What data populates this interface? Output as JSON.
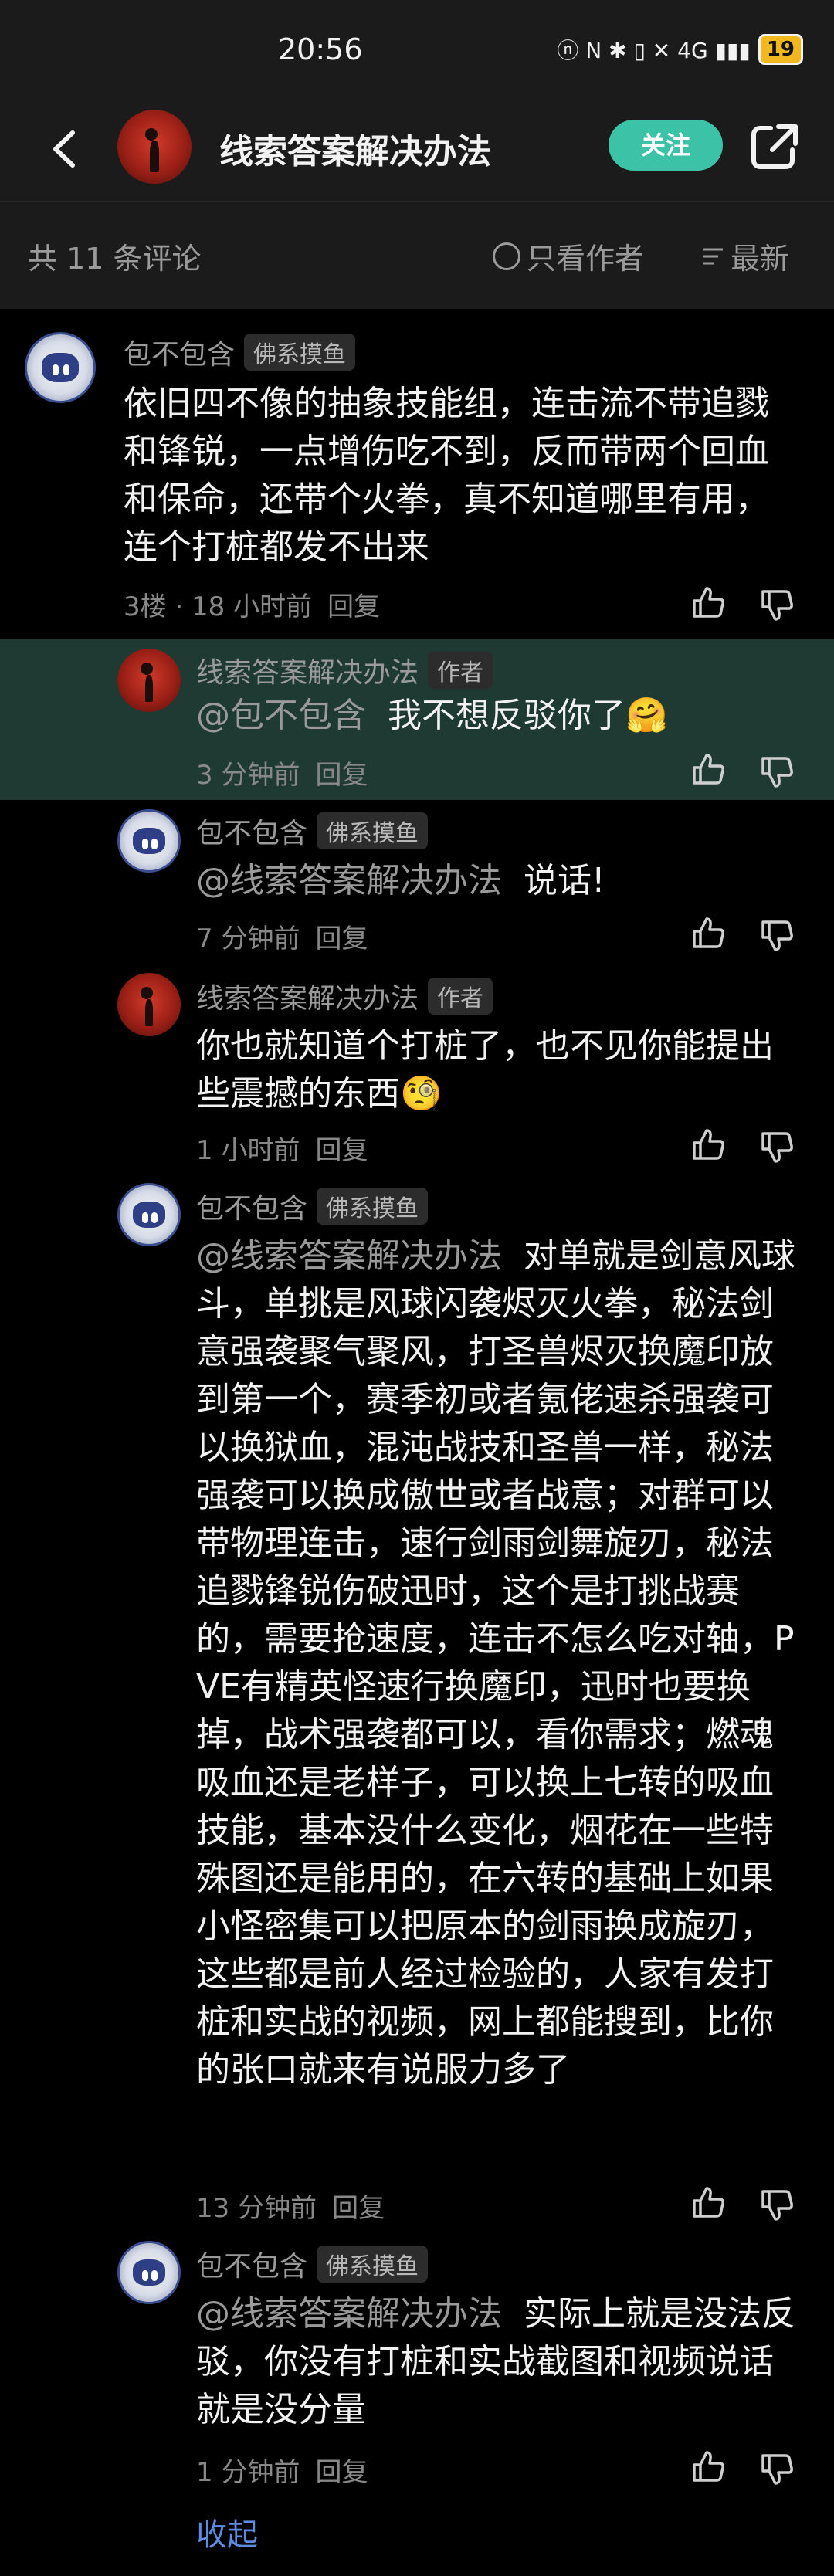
{
  "status_bar": {
    "time": "20:56",
    "icons": "ⓝ N ✱ ▯ ✕ 4G ▮▮▮",
    "battery": "19"
  },
  "header": {
    "title": "线索答案解决办法",
    "follow_label": "关注"
  },
  "filter": {
    "count": "共 11 条评论",
    "author_only": "只看作者",
    "sort": "最新"
  },
  "comments": [
    {
      "user": "包不包含",
      "tag": "佛系摸鱼",
      "text": "依旧四不像的抽象技能组，连击流不带追戮和锋锐，一点增伤吃不到，反而带两个回血和保命，还带个火拳，真不知道哪里有用，连个打桩都发不出来",
      "floor": "3楼 · 18 小时前",
      "reply_label": "回复"
    },
    {
      "user": "线索答案解决办法",
      "tag": "作者",
      "mention": "@包不包含",
      "text": "我不想反驳你了🤗",
      "time": "3 分钟前",
      "reply_label": "回复"
    },
    {
      "user": "包不包含",
      "tag": "佛系摸鱼",
      "mention": "@线索答案解决办法",
      "text": "说话!",
      "time": "7 分钟前",
      "reply_label": "回复"
    },
    {
      "user": "线索答案解决办法",
      "tag": "作者",
      "text": "你也就知道个打桩了，也不见你能提出些震撼的东西🧐",
      "time": "1 小时前",
      "reply_label": "回复"
    },
    {
      "user": "包不包含",
      "tag": "佛系摸鱼",
      "mention": "@线索答案解决办法",
      "text": "对单就是剑意风球斗，单挑是风球闪袭烬灭火拳，秘法剑意强袭聚气聚风，打圣兽烬灭换魔印放到第一个，赛季初或者氪佬速杀强袭可以换狱血，混沌战技和圣兽一样，秘法强袭可以换成傲世或者战意；对群可以带物理连击，速行剑雨剑舞旋刃，秘法追戮锋锐伤破迅时，这个是打挑战赛的，需要抢速度，连击不怎么吃对轴，PVE有精英怪速行换魔印，迅时也要换掉，战术强袭都可以，看你需求；燃魂吸血还是老样子，可以换上七转的吸血技能，基本没什么变化，烟花在一些特殊图还是能用的，在六转的基础上如果小怪密集可以把原本的剑雨换成旋刃，这些都是前人经过检验的，人家有发打桩和实战的视频，网上都能搜到，比你的张口就来有说服力多了",
      "time": "13 分钟前",
      "reply_label": "回复"
    },
    {
      "user": "包不包含",
      "tag": "佛系摸鱼",
      "mention": "@线索答案解决办法",
      "text": "实际上就是没法反驳，你没有打桩和实战截图和视频说话就是没分量",
      "time": "1 分钟前",
      "reply_label": "回复"
    }
  ],
  "collapse_label": "收起",
  "colors": {
    "background": "#000000",
    "bar": "#1b1b1b",
    "highlight": "#1e3a33",
    "accent": "#3cc3a7",
    "link": "#5d8be0"
  },
  "icons": [
    "back-arrow-icon",
    "share-icon",
    "sort-list-icon",
    "thumbs-up-icon",
    "thumbs-down-icon",
    "robot-avatar-icon"
  ]
}
